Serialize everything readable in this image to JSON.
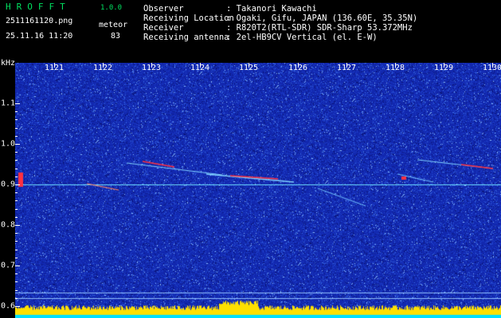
{
  "header": {
    "app_name": "HROFFT",
    "version": "1.0.0",
    "filename": "2511161120.png",
    "datetime": "25.11.16 11:20",
    "mode_label": "meteor",
    "count": "83"
  },
  "station_info": [
    {
      "label": "Observer",
      "value": ": Takanori Kawachi"
    },
    {
      "label": "Receiving Location",
      "value": ": Ogaki, Gifu, JAPAN (136.60E, 35.35N)"
    },
    {
      "label": "Receiver",
      "value": ": R820T2(RTL-SDR) SDR-Sharp 53.372MHz"
    },
    {
      "label": "Receiving antenna",
      "value": ": 2el-HB9CV Vertical (el. E-W)"
    }
  ],
  "spectrogram": {
    "y_unit": "kHz",
    "time_labels": [
      "1121",
      "1122",
      "1123",
      "1124",
      "1125",
      "1126",
      "1127",
      "1128",
      "1129",
      "1130"
    ],
    "freq_labels": [
      "1.1",
      "1.0",
      "0.9",
      "0.8",
      "0.7",
      "0.6"
    ],
    "freq_label_values": [
      1.1,
      1.0,
      0.9,
      0.8,
      0.7,
      0.6
    ],
    "carrier_khz": 0.9,
    "colors": {
      "background": "#1a2bbf",
      "carrier": "#6ee0ff",
      "signal_strong": "#ff3040",
      "bottom_bar": "#ffe000",
      "bottom_base": "#00e0ff"
    }
  }
}
